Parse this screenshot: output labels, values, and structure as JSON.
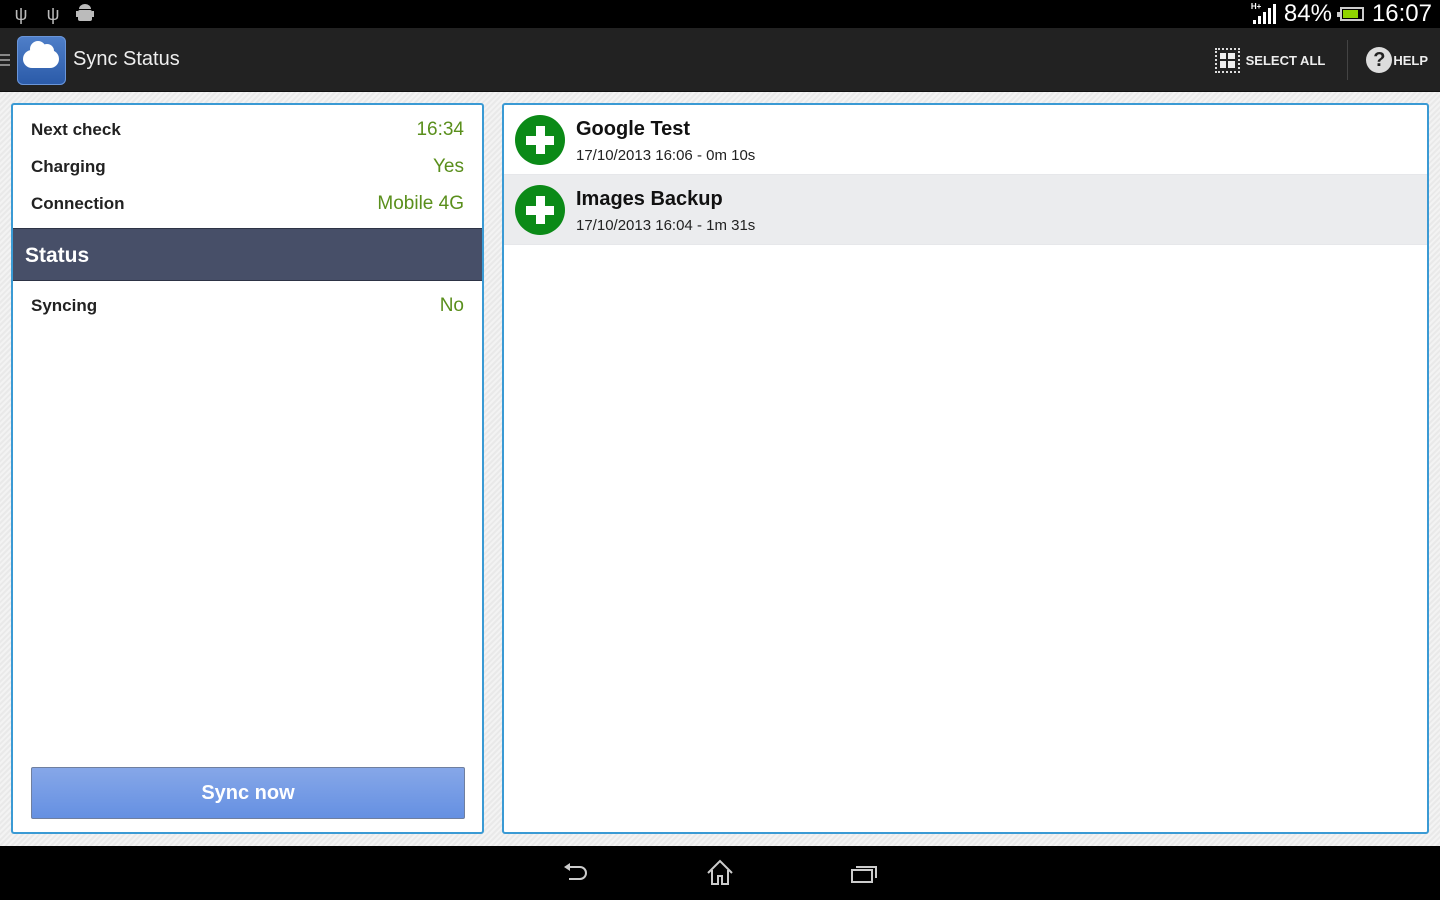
{
  "status_bar": {
    "left_icons": [
      "usb-icon",
      "usb-debug-icon",
      "android-icon"
    ],
    "network_type": "H+",
    "battery_percent": "84%",
    "battery_level": 0.84,
    "time": "16:07"
  },
  "action_bar": {
    "title": "Sync Status",
    "select_all_label": "SELECT ALL",
    "help_label": "HELP"
  },
  "left_panel": {
    "info_rows": [
      {
        "label": "Next check",
        "value": "16:34"
      },
      {
        "label": "Charging",
        "value": "Yes"
      },
      {
        "label": "Connection",
        "value": "Mobile 4G"
      }
    ],
    "section_title": "Status",
    "status_rows": [
      {
        "label": "Syncing",
        "value": "No"
      }
    ],
    "sync_button_label": "Sync now"
  },
  "jobs": [
    {
      "name": "Google Test",
      "detail": "17/10/2013 16:06 - 0m 10s"
    },
    {
      "name": "Images Backup",
      "detail": "17/10/2013 16:04 - 1m 31s"
    }
  ],
  "nav_bar": {
    "buttons": [
      "back",
      "home",
      "recent-apps"
    ]
  },
  "colors": {
    "accent_border": "#3a9ad4",
    "value_green": "#5a8f1c",
    "section_header": "#474f68",
    "job_icon_green": "#0b8a17",
    "button_blue": "#6f97e4"
  }
}
